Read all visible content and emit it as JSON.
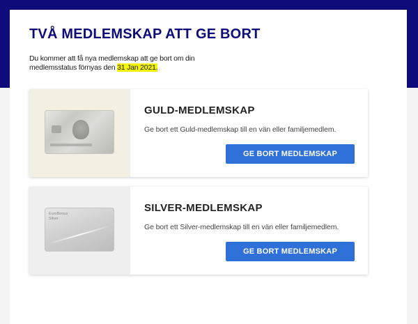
{
  "page": {
    "title": "TVÅ MEDLEMSKAP ATT GE BORT",
    "intro_text": "Du kommer att få nya medlemskap att ge bort om din medlemsstatus förnyas den",
    "renewal_date": "31 Jan 2021."
  },
  "cards": [
    {
      "title": "GULD-MEDLEMSKAP",
      "description": "Ge bort ett Guld-medlemskap till en vän eller familjemedlem.",
      "button_label": "GE BORT MEDLEMSKAP"
    },
    {
      "title": "SILVER-MEDLEMSKAP",
      "description": "Ge bort ett Silver-medlemskap till en vän eller familjemedlem.",
      "button_label": "GE BORT MEDLEMSKAP",
      "card_image_text": [
        "EuroBonus",
        "Silver"
      ]
    }
  ],
  "colors": {
    "header_band": "#0d0c7a",
    "title": "#0d0c7a",
    "button": "#2e6fd8",
    "highlight": "#f6f500"
  }
}
